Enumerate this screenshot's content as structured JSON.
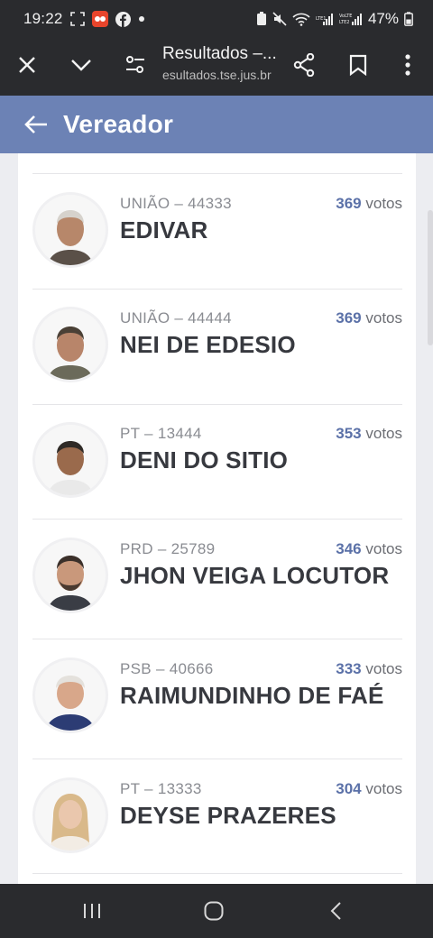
{
  "status_bar": {
    "time": "19:22",
    "battery": "47%",
    "lte1": "LTE1",
    "lte2": "LTE2",
    "volte": "VoLTE"
  },
  "browser": {
    "title": "Resultados –...",
    "url": "esultados.tse.jus.br"
  },
  "header": {
    "title": "Vereador"
  },
  "votes_suffix": "votos",
  "candidates": [
    {
      "party": "UNIÃO – 44333",
      "name": "EDIVAR",
      "votes": "369"
    },
    {
      "party": "UNIÃO – 44444",
      "name": "NEI DE EDESIO",
      "votes": "369"
    },
    {
      "party": "PT – 13444",
      "name": "DENI DO SITIO",
      "votes": "353"
    },
    {
      "party": "PRD – 25789",
      "name": "JHON VEIGA LOCUTOR",
      "votes": "346"
    },
    {
      "party": "PSB – 40666",
      "name": "RAIMUNDINHO DE FAÉ",
      "votes": "333"
    },
    {
      "party": "PT – 13333",
      "name": "DEYSE PRAZERES",
      "votes": "304"
    }
  ],
  "colors": {
    "header": "#6c82b5",
    "votes_accent": "#5b71a8",
    "chrome": "#2a2b2e"
  }
}
